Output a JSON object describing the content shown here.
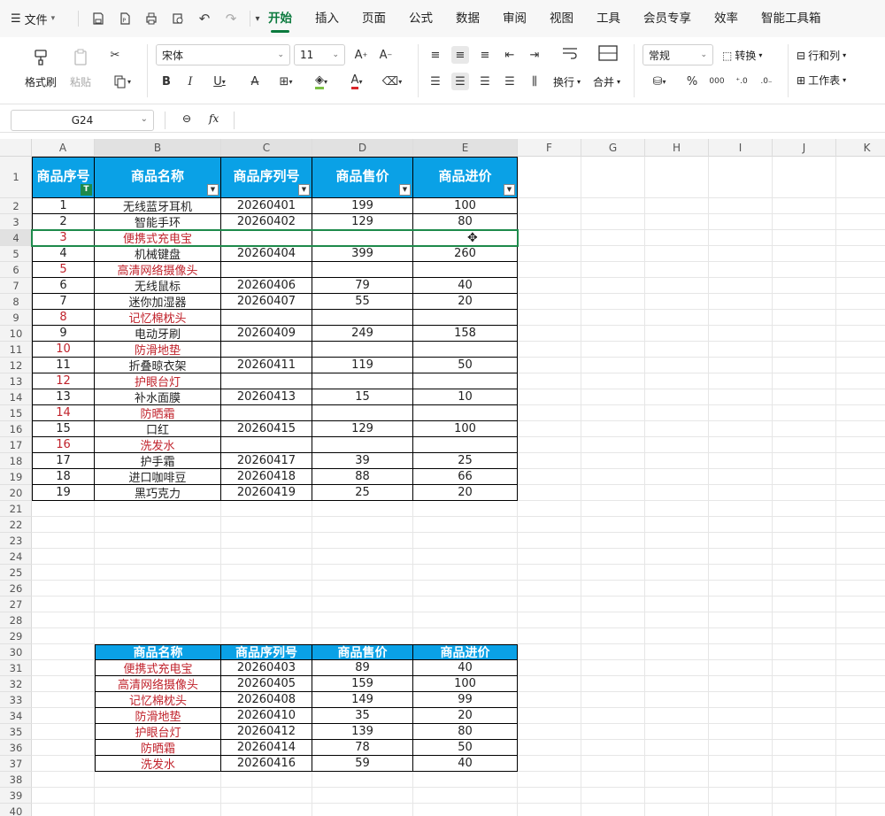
{
  "menu": {
    "file_label": "文件",
    "tabs": [
      "开始",
      "插入",
      "页面",
      "公式",
      "数据",
      "审阅",
      "视图",
      "工具",
      "会员专享",
      "效率",
      "智能工具箱"
    ],
    "active_tab": 0
  },
  "ribbon": {
    "format_painter": "格式刷",
    "paste": "粘贴",
    "font_name": "宋体",
    "font_size": "11",
    "wrap": "换行",
    "merge": "合并",
    "number_format": "常规",
    "convert": "转换",
    "row_col": "行和列",
    "worksheet": "工作表"
  },
  "formula_bar": {
    "cell_ref": "G24",
    "fx": "fx",
    "value": ""
  },
  "columns": [
    "A",
    "B",
    "C",
    "D",
    "E",
    "F",
    "G",
    "H",
    "I",
    "J",
    "K"
  ],
  "rows": [
    "1",
    "2",
    "3",
    "4",
    "5",
    "6",
    "7",
    "8",
    "9",
    "10",
    "11",
    "12",
    "13",
    "14",
    "15",
    "16",
    "17",
    "18",
    "19",
    "20",
    "21",
    "22",
    "23",
    "24",
    "25",
    "26",
    "27",
    "28",
    "29",
    "30",
    "31",
    "32",
    "33",
    "34",
    "35",
    "36",
    "37",
    "38",
    "39",
    "40"
  ],
  "table1": {
    "headers": [
      "商品序号",
      "商品名称",
      "商品序列号",
      "商品售价",
      "商品进价"
    ],
    "rows": [
      [
        "1",
        "无线蓝牙耳机",
        "20260401",
        "199",
        "100"
      ],
      [
        "2",
        "智能手环",
        "20260402",
        "129",
        "80"
      ],
      [
        "3",
        "便携式充电宝",
        "",
        "",
        ""
      ],
      [
        "4",
        "机械键盘",
        "20260404",
        "399",
        "260"
      ],
      [
        "5",
        "高清网络摄像头",
        "",
        "",
        ""
      ],
      [
        "6",
        "无线鼠标",
        "20260406",
        "79",
        "40"
      ],
      [
        "7",
        "迷你加湿器",
        "20260407",
        "55",
        "20"
      ],
      [
        "8",
        "记忆棉枕头",
        "",
        "",
        ""
      ],
      [
        "9",
        "电动牙刷",
        "20260409",
        "249",
        "158"
      ],
      [
        "10",
        "防滑地垫",
        "",
        "",
        ""
      ],
      [
        "11",
        "折叠晾衣架",
        "20260411",
        "119",
        "50"
      ],
      [
        "12",
        "护眼台灯",
        "",
        "",
        ""
      ],
      [
        "13",
        "补水面膜",
        "20260413",
        "15",
        "10"
      ],
      [
        "14",
        "防晒霜",
        "",
        "",
        ""
      ],
      [
        "15",
        "口红",
        "20260415",
        "129",
        "100"
      ],
      [
        "16",
        "洗发水",
        "",
        "",
        ""
      ],
      [
        "17",
        "护手霜",
        "20260417",
        "39",
        "25"
      ],
      [
        "18",
        "进口咖啡豆",
        "20260418",
        "88",
        "66"
      ],
      [
        "19",
        "黑巧克力",
        "20260419",
        "25",
        "20"
      ]
    ],
    "red_rows": [
      2,
      4,
      7,
      9,
      11,
      13,
      15
    ]
  },
  "table2": {
    "headers": [
      "商品名称",
      "商品序列号",
      "商品售价",
      "商品进价"
    ],
    "rows": [
      [
        "便携式充电宝",
        "20260403",
        "89",
        "40"
      ],
      [
        "高清网络摄像头",
        "20260405",
        "159",
        "100"
      ],
      [
        "记忆棉枕头",
        "20260408",
        "149",
        "99"
      ],
      [
        "防滑地垫",
        "20260410",
        "35",
        "20"
      ],
      [
        "护眼台灯",
        "20260412",
        "139",
        "80"
      ],
      [
        "防晒霜",
        "20260414",
        "78",
        "50"
      ],
      [
        "洗发水",
        "20260416",
        "59",
        "40"
      ]
    ]
  },
  "colors": {
    "header_bg": "#0aa1e6",
    "accent": "#0c7a3e",
    "red_text": "#c0222b"
  }
}
